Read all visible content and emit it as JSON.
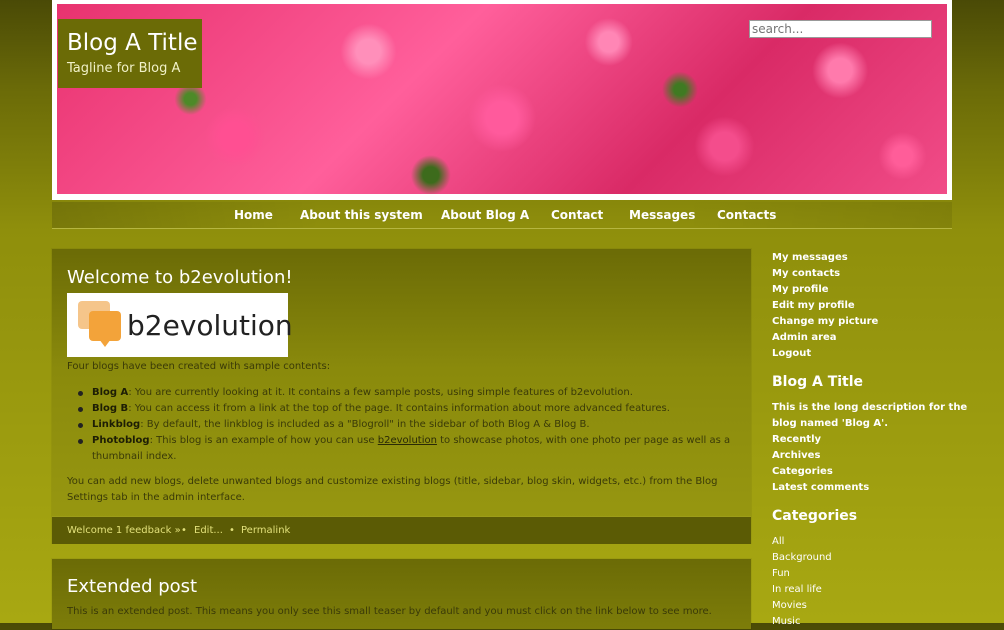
{
  "header": {
    "title": "Blog A Title",
    "tagline": "Tagline for Blog A",
    "search_placeholder": "search..."
  },
  "nav": [
    "Home",
    "About this system",
    "About Blog A",
    "Contact",
    "Messages",
    "Contacts"
  ],
  "post1": {
    "title": "Welcome to b2evolution!",
    "logo_text": "b2evolution",
    "intro": "Four blogs have been created with sample contents:",
    "items": [
      {
        "bold": "Blog A",
        "text": ": You are currently looking at it. It contains a few sample posts, using simple features of b2evolution."
      },
      {
        "bold": "Blog B",
        "text": ": You can access it from a link at the top of the page. It contains information about more advanced features."
      },
      {
        "bold": "Linkblog",
        "text": ": By default, the linkblog is included as a \"Blogroll\" in the sidebar of both Blog A & Blog B."
      },
      {
        "bold": "Photoblog",
        "text_a": ": This blog is an example of how you can use ",
        "link": "b2evolution",
        "text_b": " to showcase photos, with one photo per page as well as a thumbnail index."
      }
    ],
    "outro": "You can add new blogs, delete unwanted blogs and customize existing blogs (title, sidebar, blog skin, widgets, etc.) from the Blog Settings tab in the admin interface.",
    "footer": {
      "feedback": "Welcome 1 feedback »",
      "bullet": "•",
      "edit": "Edit...",
      "permalink": "Permalink"
    }
  },
  "post2": {
    "title": "Extended post",
    "text": "This is an extended post. This means you only see this small teaser by default and you must click on the link below to see more."
  },
  "sidebar": {
    "user_links": [
      "My messages",
      "My contacts",
      "My profile",
      "Edit my profile",
      "Change my picture",
      "Admin area",
      "Logout"
    ],
    "blog_title": "Blog A Title",
    "blog_desc_1": "This is the long description for the",
    "blog_desc_2": "blog named 'Blog A'.",
    "blog_links": [
      "Recently",
      "Archives",
      "Categories",
      "Latest comments"
    ],
    "categories_head": "Categories",
    "categories": [
      "All",
      "Background",
      "Fun",
      "In real life",
      "Movies",
      "Music"
    ]
  },
  "colors": {
    "accent": "#a8a812",
    "header_box": "#6b6b06",
    "footer_bar": "#5b5b05"
  }
}
